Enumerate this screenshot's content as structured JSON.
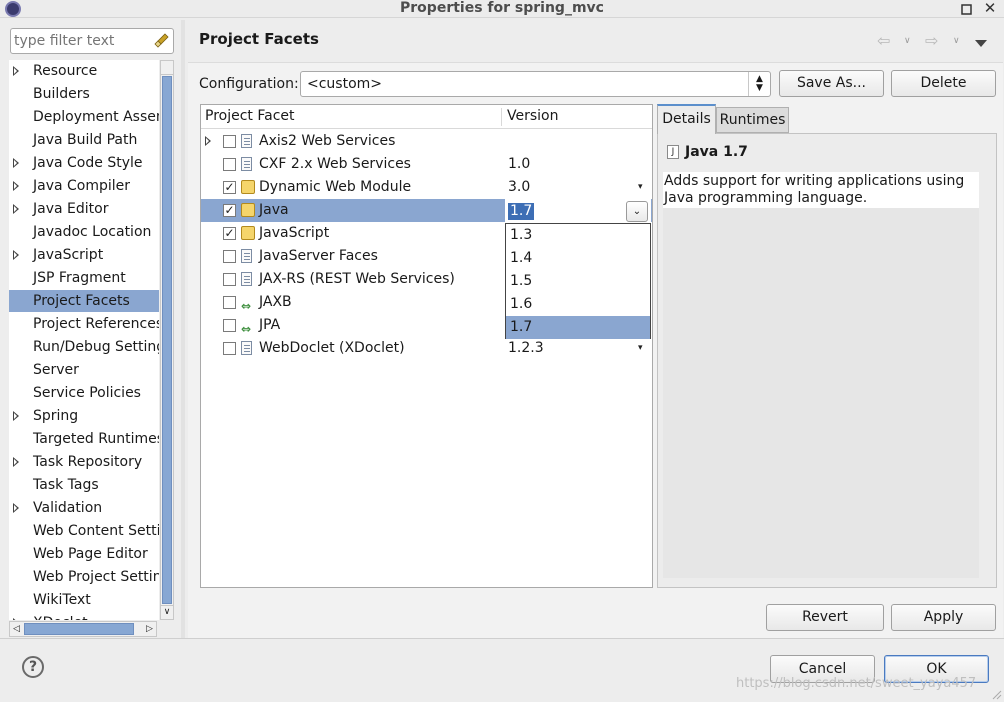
{
  "window": {
    "title": "Properties for spring_mvc"
  },
  "filter": {
    "placeholder": "type filter text"
  },
  "sidebar": {
    "items": [
      {
        "label": "Resource",
        "expandable": true
      },
      {
        "label": "Builders",
        "expandable": false
      },
      {
        "label": "Deployment Assem",
        "expandable": false
      },
      {
        "label": "Java Build Path",
        "expandable": false
      },
      {
        "label": "Java Code Style",
        "expandable": true
      },
      {
        "label": "Java Compiler",
        "expandable": true
      },
      {
        "label": "Java Editor",
        "expandable": true
      },
      {
        "label": "Javadoc Location",
        "expandable": false
      },
      {
        "label": "JavaScript",
        "expandable": true
      },
      {
        "label": "JSP Fragment",
        "expandable": false
      },
      {
        "label": "Project Facets",
        "expandable": false,
        "selected": true
      },
      {
        "label": "Project References",
        "expandable": false
      },
      {
        "label": "Run/Debug Settings",
        "expandable": false
      },
      {
        "label": "Server",
        "expandable": false
      },
      {
        "label": "Service Policies",
        "expandable": false
      },
      {
        "label": "Spring",
        "expandable": true
      },
      {
        "label": "Targeted Runtimes",
        "expandable": false
      },
      {
        "label": "Task Repository",
        "expandable": true
      },
      {
        "label": "Task Tags",
        "expandable": false
      },
      {
        "label": "Validation",
        "expandable": true
      },
      {
        "label": "Web Content Settin",
        "expandable": false
      },
      {
        "label": "Web Page Editor",
        "expandable": false
      },
      {
        "label": "Web Project Setting",
        "expandable": false
      },
      {
        "label": "WikiText",
        "expandable": false
      },
      {
        "label": "XDoclet",
        "expandable": true
      }
    ]
  },
  "page": {
    "title": "Project Facets"
  },
  "config": {
    "label": "Configuration:",
    "value": "<custom>",
    "save_as": "Save As...",
    "delete": "Delete"
  },
  "facets": {
    "columns": [
      "Project Facet",
      "Version"
    ],
    "rows": [
      {
        "name": "Axis2 Web Services",
        "version": "",
        "checked": false,
        "expandable": true,
        "icon": "doc-icon",
        "dropdown": false
      },
      {
        "name": "CXF 2.x Web Services",
        "version": "1.0",
        "checked": false,
        "expandable": false,
        "icon": "doc-icon",
        "dropdown": false
      },
      {
        "name": "Dynamic Web Module",
        "version": "3.0",
        "checked": true,
        "expandable": false,
        "icon": "lock-icon",
        "dropdown": true
      },
      {
        "name": "Java",
        "version": "",
        "checked": true,
        "expandable": false,
        "icon": "lock-icon",
        "dropdown": false,
        "selected": true
      },
      {
        "name": "JavaScript",
        "version": "",
        "checked": true,
        "expandable": false,
        "icon": "lock-icon",
        "dropdown": false
      },
      {
        "name": "JavaServer Faces",
        "version": "",
        "checked": false,
        "expandable": false,
        "icon": "doc-icon",
        "dropdown": false
      },
      {
        "name": "JAX-RS (REST Web Services)",
        "version": "",
        "checked": false,
        "expandable": false,
        "icon": "doc-icon",
        "dropdown": false
      },
      {
        "name": "JAXB",
        "version": "",
        "checked": false,
        "expandable": false,
        "icon": "arrow-icon",
        "dropdown": false
      },
      {
        "name": "JPA",
        "version": "",
        "checked": false,
        "expandable": false,
        "icon": "arrow-icon",
        "dropdown": false
      },
      {
        "name": "WebDoclet (XDoclet)",
        "version": "1.2.3",
        "checked": false,
        "expandable": false,
        "icon": "doc-icon",
        "dropdown": true
      }
    ],
    "editor_value": "1.7",
    "version_options": [
      "1.3",
      "1.4",
      "1.5",
      "1.6",
      "1.7"
    ],
    "selected_option": "1.7"
  },
  "details": {
    "tabs": [
      "Details",
      "Runtimes"
    ],
    "heading": "Java 1.7",
    "description": "Adds support for writing applications using Java programming language."
  },
  "buttons": {
    "revert": "Revert",
    "apply": "Apply",
    "cancel": "Cancel",
    "ok": "OK"
  },
  "help": {
    "glyph": "?"
  },
  "watermark": "https://blog.csdn.net/sweet_yaya457",
  "colors": {
    "selection": "#8aa6d0",
    "accent": "#3d6eb5"
  }
}
